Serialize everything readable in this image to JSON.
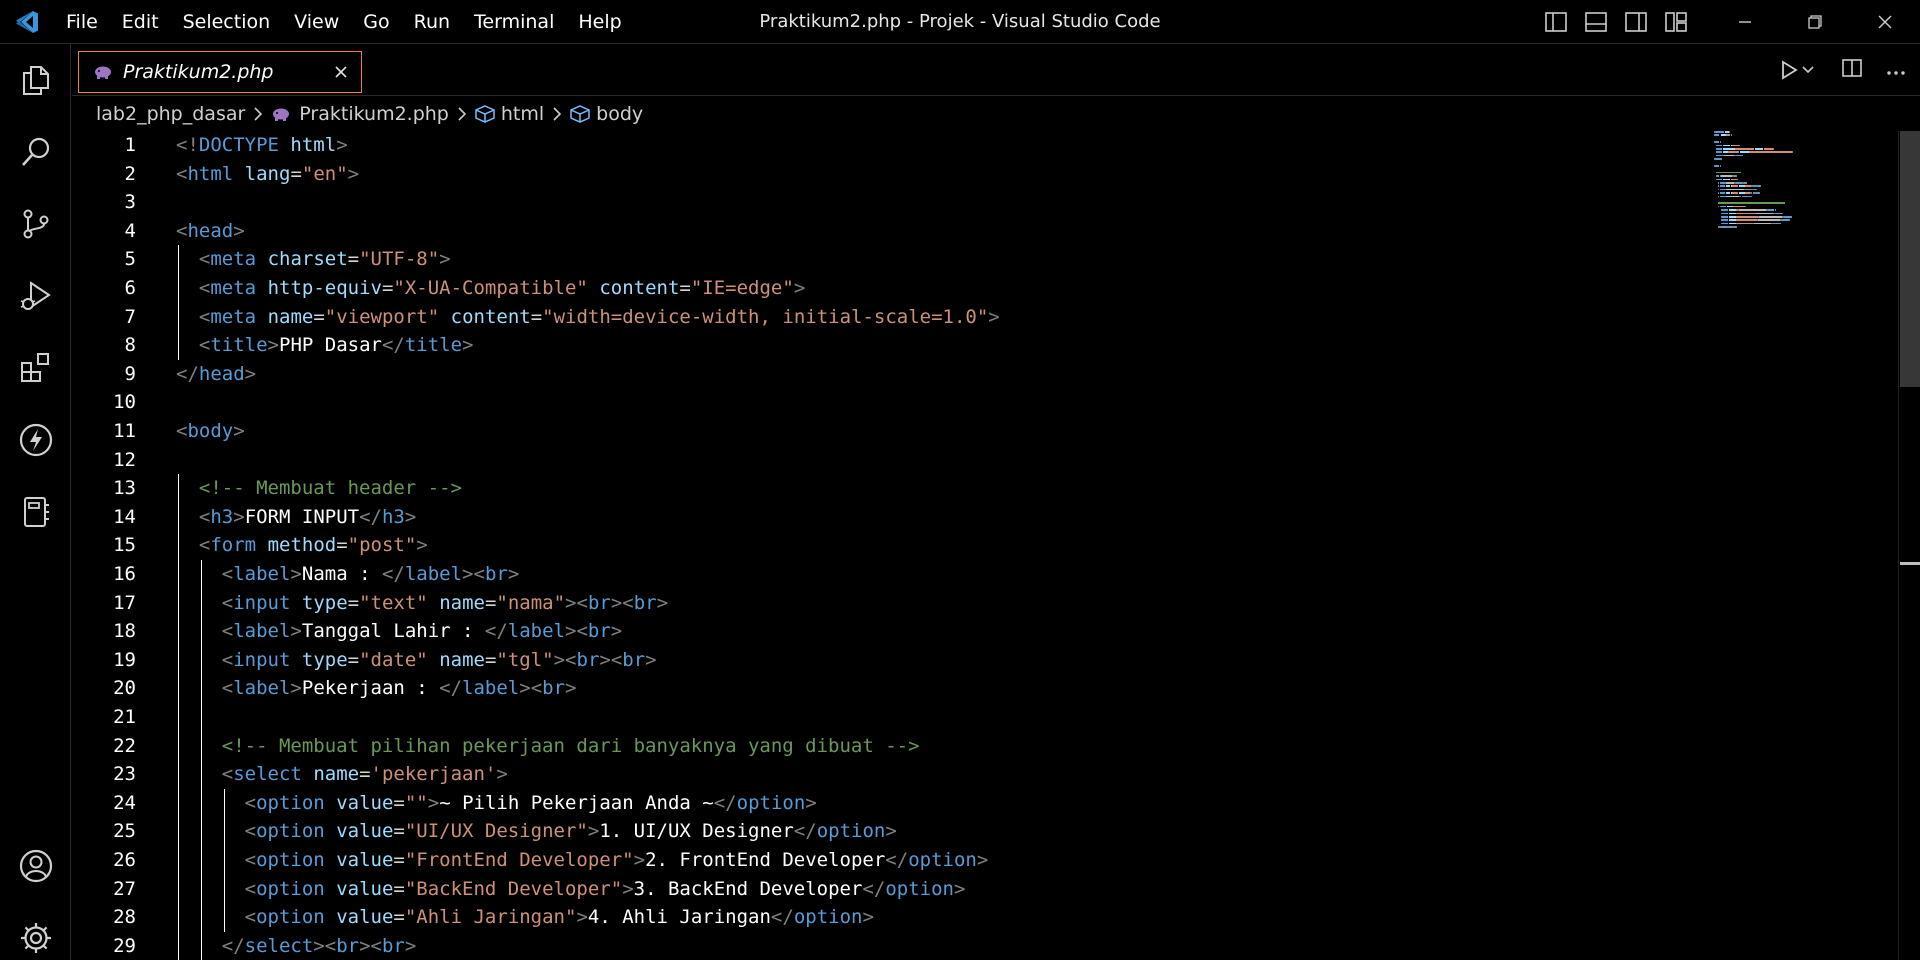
{
  "window": {
    "title": "Praktikum2.php - Projek - Visual Studio Code"
  },
  "menu": [
    "File",
    "Edit",
    "Selection",
    "View",
    "Go",
    "Run",
    "Terminal",
    "Help"
  ],
  "tab": {
    "label": "Praktikum2.php"
  },
  "breadcrumb": [
    "lab2_php_dasar",
    "Praktikum2.php",
    "html",
    "body"
  ],
  "colors": {
    "vscode_blue": "#3a96dd",
    "tab_border": "#f38518",
    "tag": "#569cd6",
    "attribute": "#9cdcfe",
    "string": "#ce9178",
    "comment": "#6a9955"
  },
  "code": [
    {
      "n": "1",
      "tokens": [
        [
          "b",
          "<!"
        ],
        [
          "t",
          "DOCTYPE"
        ],
        [
          "x",
          " "
        ],
        [
          "a",
          "html"
        ],
        [
          "b",
          ">"
        ]
      ]
    },
    {
      "n": "2",
      "tokens": [
        [
          "b",
          "<"
        ],
        [
          "t",
          "html"
        ],
        [
          "x",
          " "
        ],
        [
          "a",
          "lang"
        ],
        [
          "e",
          "="
        ],
        [
          "s",
          "\"en\""
        ],
        [
          "b",
          ">"
        ]
      ]
    },
    {
      "n": "3",
      "tokens": []
    },
    {
      "n": "4",
      "tokens": [
        [
          "b",
          "<"
        ],
        [
          "t",
          "head"
        ],
        [
          "b",
          ">"
        ]
      ]
    },
    {
      "n": "5",
      "tokens": [
        [
          "x",
          "  "
        ],
        [
          "b",
          "<"
        ],
        [
          "t",
          "meta"
        ],
        [
          "x",
          " "
        ],
        [
          "a",
          "charset"
        ],
        [
          "e",
          "="
        ],
        [
          "s",
          "\"UTF-8\""
        ],
        [
          "b",
          ">"
        ]
      ]
    },
    {
      "n": "6",
      "tokens": [
        [
          "x",
          "  "
        ],
        [
          "b",
          "<"
        ],
        [
          "t",
          "meta"
        ],
        [
          "x",
          " "
        ],
        [
          "a",
          "http-equiv"
        ],
        [
          "e",
          "="
        ],
        [
          "s",
          "\"X-UA-Compatible\""
        ],
        [
          "x",
          " "
        ],
        [
          "a",
          "content"
        ],
        [
          "e",
          "="
        ],
        [
          "s",
          "\"IE=edge\""
        ],
        [
          "b",
          ">"
        ]
      ]
    },
    {
      "n": "7",
      "tokens": [
        [
          "x",
          "  "
        ],
        [
          "b",
          "<"
        ],
        [
          "t",
          "meta"
        ],
        [
          "x",
          " "
        ],
        [
          "a",
          "name"
        ],
        [
          "e",
          "="
        ],
        [
          "s",
          "\"viewport\""
        ],
        [
          "x",
          " "
        ],
        [
          "a",
          "content"
        ],
        [
          "e",
          "="
        ],
        [
          "s",
          "\"width=device-width, initial-scale=1.0\""
        ],
        [
          "b",
          ">"
        ]
      ]
    },
    {
      "n": "8",
      "tokens": [
        [
          "x",
          "  "
        ],
        [
          "b",
          "<"
        ],
        [
          "t",
          "title"
        ],
        [
          "b",
          ">"
        ],
        [
          "x",
          "PHP Dasar"
        ],
        [
          "b",
          "</"
        ],
        [
          "t",
          "title"
        ],
        [
          "b",
          ">"
        ]
      ]
    },
    {
      "n": "9",
      "tokens": [
        [
          "b",
          "</"
        ],
        [
          "t",
          "head"
        ],
        [
          "b",
          ">"
        ]
      ]
    },
    {
      "n": "10",
      "tokens": []
    },
    {
      "n": "11",
      "tokens": [
        [
          "b",
          "<"
        ],
        [
          "t",
          "body"
        ],
        [
          "b",
          ">"
        ]
      ]
    },
    {
      "n": "12",
      "tokens": []
    },
    {
      "n": "13",
      "tokens": [
        [
          "x",
          "  "
        ],
        [
          "c",
          "<!-- Membuat header -->"
        ]
      ]
    },
    {
      "n": "14",
      "tokens": [
        [
          "x",
          "  "
        ],
        [
          "b",
          "<"
        ],
        [
          "t",
          "h3"
        ],
        [
          "b",
          ">"
        ],
        [
          "x",
          "FORM INPUT"
        ],
        [
          "b",
          "</"
        ],
        [
          "t",
          "h3"
        ],
        [
          "b",
          ">"
        ]
      ]
    },
    {
      "n": "15",
      "tokens": [
        [
          "x",
          "  "
        ],
        [
          "b",
          "<"
        ],
        [
          "t",
          "form"
        ],
        [
          "x",
          " "
        ],
        [
          "a",
          "method"
        ],
        [
          "e",
          "="
        ],
        [
          "s",
          "\"post\""
        ],
        [
          "b",
          ">"
        ]
      ]
    },
    {
      "n": "16",
      "tokens": [
        [
          "x",
          "    "
        ],
        [
          "b",
          "<"
        ],
        [
          "t",
          "label"
        ],
        [
          "b",
          ">"
        ],
        [
          "x",
          "Nama : "
        ],
        [
          "b",
          "</"
        ],
        [
          "t",
          "label"
        ],
        [
          "b",
          "><"
        ],
        [
          "t",
          "br"
        ],
        [
          "b",
          ">"
        ]
      ]
    },
    {
      "n": "17",
      "tokens": [
        [
          "x",
          "    "
        ],
        [
          "b",
          "<"
        ],
        [
          "t",
          "input"
        ],
        [
          "x",
          " "
        ],
        [
          "a",
          "type"
        ],
        [
          "e",
          "="
        ],
        [
          "s",
          "\"text\""
        ],
        [
          "x",
          " "
        ],
        [
          "a",
          "name"
        ],
        [
          "e",
          "="
        ],
        [
          "s",
          "\"nama\""
        ],
        [
          "b",
          "><"
        ],
        [
          "t",
          "br"
        ],
        [
          "b",
          "><"
        ],
        [
          "t",
          "br"
        ],
        [
          "b",
          ">"
        ]
      ]
    },
    {
      "n": "18",
      "tokens": [
        [
          "x",
          "    "
        ],
        [
          "b",
          "<"
        ],
        [
          "t",
          "label"
        ],
        [
          "b",
          ">"
        ],
        [
          "x",
          "Tanggal Lahir : "
        ],
        [
          "b",
          "</"
        ],
        [
          "t",
          "label"
        ],
        [
          "b",
          "><"
        ],
        [
          "t",
          "br"
        ],
        [
          "b",
          ">"
        ]
      ]
    },
    {
      "n": "19",
      "tokens": [
        [
          "x",
          "    "
        ],
        [
          "b",
          "<"
        ],
        [
          "t",
          "input"
        ],
        [
          "x",
          " "
        ],
        [
          "a",
          "type"
        ],
        [
          "e",
          "="
        ],
        [
          "s",
          "\"date\""
        ],
        [
          "x",
          " "
        ],
        [
          "a",
          "name"
        ],
        [
          "e",
          "="
        ],
        [
          "s",
          "\"tgl\""
        ],
        [
          "b",
          "><"
        ],
        [
          "t",
          "br"
        ],
        [
          "b",
          "><"
        ],
        [
          "t",
          "br"
        ],
        [
          "b",
          ">"
        ]
      ]
    },
    {
      "n": "20",
      "tokens": [
        [
          "x",
          "    "
        ],
        [
          "b",
          "<"
        ],
        [
          "t",
          "label"
        ],
        [
          "b",
          ">"
        ],
        [
          "x",
          "Pekerjaan : "
        ],
        [
          "b",
          "</"
        ],
        [
          "t",
          "label"
        ],
        [
          "b",
          "><"
        ],
        [
          "t",
          "br"
        ],
        [
          "b",
          ">"
        ]
      ]
    },
    {
      "n": "21",
      "tokens": []
    },
    {
      "n": "22",
      "tokens": [
        [
          "x",
          "    "
        ],
        [
          "c",
          "<!-- Membuat pilihan pekerjaan dari banyaknya yang dibuat -->"
        ]
      ]
    },
    {
      "n": "23",
      "tokens": [
        [
          "x",
          "    "
        ],
        [
          "b",
          "<"
        ],
        [
          "t",
          "select"
        ],
        [
          "x",
          " "
        ],
        [
          "a",
          "name"
        ],
        [
          "e",
          "="
        ],
        [
          "s",
          "'pekerjaan'"
        ],
        [
          "b",
          ">"
        ]
      ]
    },
    {
      "n": "24",
      "tokens": [
        [
          "x",
          "      "
        ],
        [
          "b",
          "<"
        ],
        [
          "t",
          "option"
        ],
        [
          "x",
          " "
        ],
        [
          "a",
          "value"
        ],
        [
          "e",
          "="
        ],
        [
          "s",
          "\"\""
        ],
        [
          "b",
          ">"
        ],
        [
          "x",
          "~ Pilih Pekerjaan Anda ~"
        ],
        [
          "b",
          "</"
        ],
        [
          "t",
          "option"
        ],
        [
          "b",
          ">"
        ]
      ]
    },
    {
      "n": "25",
      "tokens": [
        [
          "x",
          "      "
        ],
        [
          "b",
          "<"
        ],
        [
          "t",
          "option"
        ],
        [
          "x",
          " "
        ],
        [
          "a",
          "value"
        ],
        [
          "e",
          "="
        ],
        [
          "s",
          "\"UI/UX Designer\""
        ],
        [
          "b",
          ">"
        ],
        [
          "x",
          "1. UI/UX Designer"
        ],
        [
          "b",
          "</"
        ],
        [
          "t",
          "option"
        ],
        [
          "b",
          ">"
        ]
      ]
    },
    {
      "n": "26",
      "tokens": [
        [
          "x",
          "      "
        ],
        [
          "b",
          "<"
        ],
        [
          "t",
          "option"
        ],
        [
          "x",
          " "
        ],
        [
          "a",
          "value"
        ],
        [
          "e",
          "="
        ],
        [
          "s",
          "\"FrontEnd Developer\""
        ],
        [
          "b",
          ">"
        ],
        [
          "x",
          "2. FrontEnd Developer"
        ],
        [
          "b",
          "</"
        ],
        [
          "t",
          "option"
        ],
        [
          "b",
          ">"
        ]
      ]
    },
    {
      "n": "27",
      "tokens": [
        [
          "x",
          "      "
        ],
        [
          "b",
          "<"
        ],
        [
          "t",
          "option"
        ],
        [
          "x",
          " "
        ],
        [
          "a",
          "value"
        ],
        [
          "e",
          "="
        ],
        [
          "s",
          "\"BackEnd Developer\""
        ],
        [
          "b",
          ">"
        ],
        [
          "x",
          "3. BackEnd Developer"
        ],
        [
          "b",
          "</"
        ],
        [
          "t",
          "option"
        ],
        [
          "b",
          ">"
        ]
      ]
    },
    {
      "n": "28",
      "tokens": [
        [
          "x",
          "      "
        ],
        [
          "b",
          "<"
        ],
        [
          "t",
          "option"
        ],
        [
          "x",
          " "
        ],
        [
          "a",
          "value"
        ],
        [
          "e",
          "="
        ],
        [
          "s",
          "\"Ahli Jaringan\""
        ],
        [
          "b",
          ">"
        ],
        [
          "x",
          "4. Ahli Jaringan"
        ],
        [
          "b",
          "</"
        ],
        [
          "t",
          "option"
        ],
        [
          "b",
          ">"
        ]
      ]
    },
    {
      "n": "29",
      "tokens": [
        [
          "x",
          "    "
        ],
        [
          "b",
          "</"
        ],
        [
          "t",
          "select"
        ],
        [
          "b",
          "><"
        ],
        [
          "t",
          "br"
        ],
        [
          "b",
          "><"
        ],
        [
          "t",
          "br"
        ],
        [
          "b",
          ">"
        ]
      ]
    }
  ]
}
